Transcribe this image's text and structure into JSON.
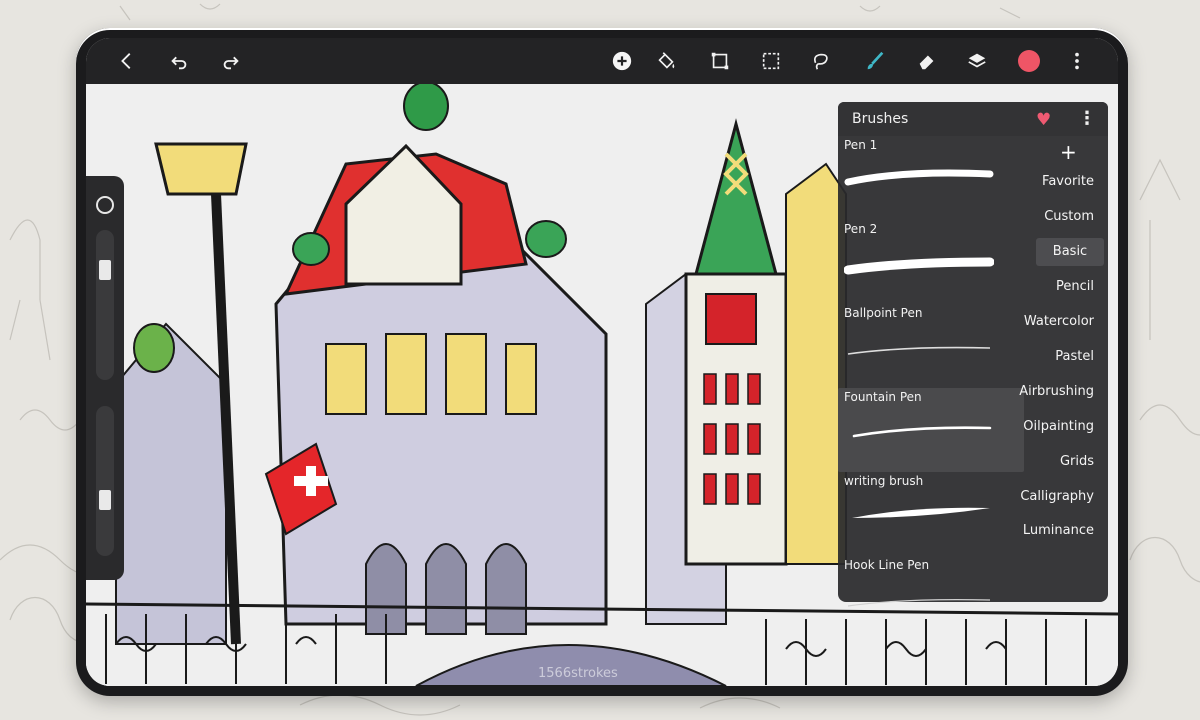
{
  "toolbar": {
    "buttons": [
      {
        "icon": "back-icon"
      },
      {
        "icon": "undo-icon"
      },
      {
        "icon": "redo-icon"
      },
      {
        "icon": "add-circle-icon"
      },
      {
        "icon": "fill-bucket-icon"
      },
      {
        "icon": "transform-icon"
      },
      {
        "icon": "selection-icon"
      },
      {
        "icon": "lasso-icon"
      },
      {
        "icon": "brush-icon"
      },
      {
        "icon": "eraser-icon"
      },
      {
        "icon": "layers-icon"
      },
      {
        "icon": "color-swatch",
        "color": "#ef5566"
      },
      {
        "icon": "more-vertical-icon"
      }
    ]
  },
  "brush_panel": {
    "title": "Brushes",
    "menu_glyph": "⋮",
    "heart_glyph": "♥",
    "add_glyph": "+",
    "brushes": [
      {
        "name": "Pen 1"
      },
      {
        "name": "Pen 2"
      },
      {
        "name": "Ballpoint Pen"
      },
      {
        "name": "Fountain Pen",
        "selected": true
      },
      {
        "name": "writing brush"
      },
      {
        "name": "Hook Line Pen"
      }
    ],
    "categories": [
      {
        "label": "Favorite"
      },
      {
        "label": "Custom"
      },
      {
        "label": "Basic",
        "active": true
      },
      {
        "label": "Pencil"
      },
      {
        "label": "Watercolor"
      },
      {
        "label": "Pastel"
      },
      {
        "label": "Airbrushing"
      },
      {
        "label": "Oilpainting"
      },
      {
        "label": "Grids"
      },
      {
        "label": "Calligraphy"
      },
      {
        "label": "Luminance"
      }
    ]
  },
  "status": {
    "strokes": "1566strokes"
  },
  "colors": {
    "accent": "#ef5566",
    "panel_bg": "#2a2a2c",
    "toolbar_bg": "#232325"
  }
}
